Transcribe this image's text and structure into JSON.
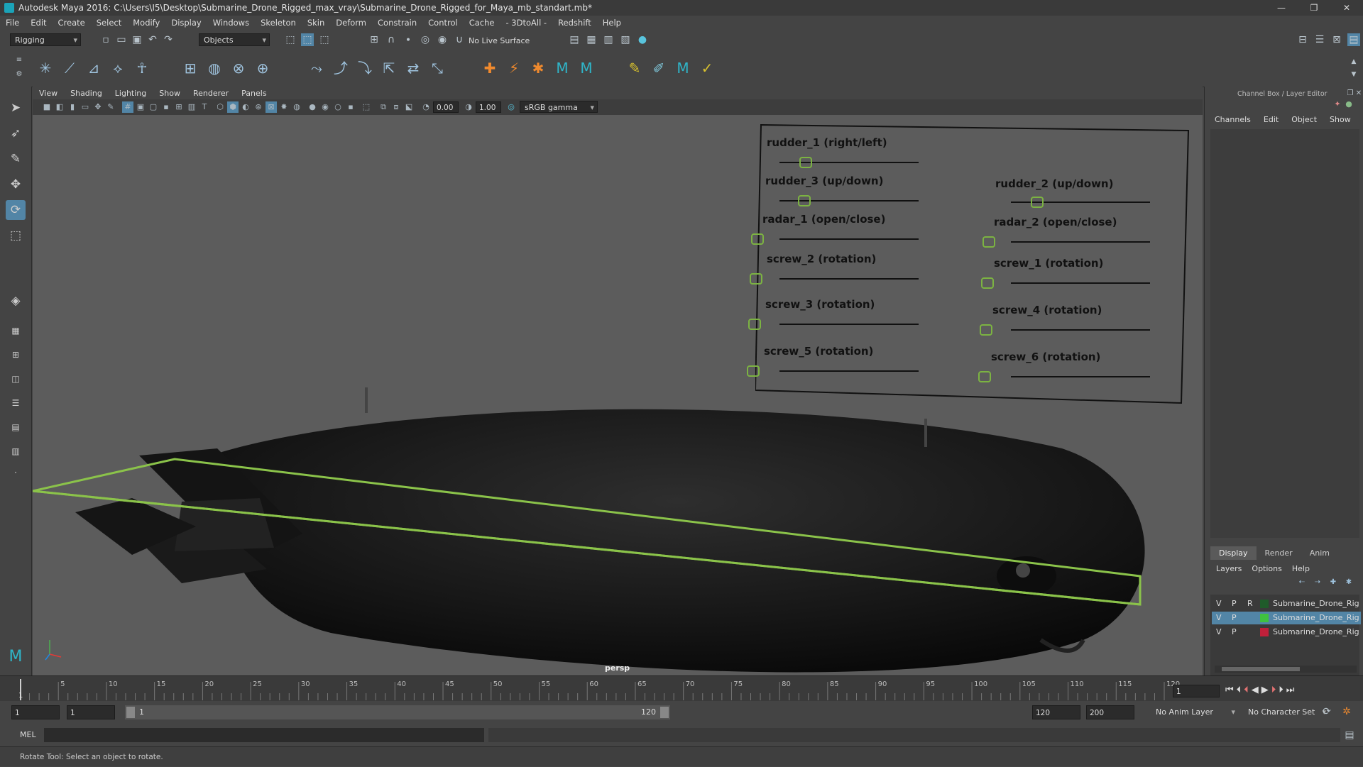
{
  "window": {
    "title": "Autodesk Maya 2016: C:\\Users\\I5\\Desktop\\Submarine_Drone_Rigged_max_vray\\Submarine_Drone_Rigged_for_Maya_mb_standart.mb*",
    "controls": [
      "—",
      "❐",
      "✕"
    ]
  },
  "menubar": [
    "File",
    "Edit",
    "Create",
    "Select",
    "Modify",
    "Display",
    "Windows",
    "Skeleton",
    "Skin",
    "Deform",
    "Constrain",
    "Control",
    "Cache",
    "- 3DtoAll -",
    "Redshift",
    "Help"
  ],
  "statusline": {
    "mode": "Rigging",
    "selection_mode": "Objects",
    "live_surface": "No Live Surface"
  },
  "panel": {
    "menu": [
      "View",
      "Shading",
      "Lighting",
      "Show",
      "Renderer",
      "Panels"
    ],
    "exposure": "0.00",
    "gamma": "1.00",
    "color_space": "sRGB gamma",
    "camera_label": "persp"
  },
  "rig_controls": {
    "left": [
      "rudder_1 (right/left)",
      "rudder_3 (up/down)",
      "radar_1 (open/close)",
      "screw_2 (rotation)",
      "screw_3 (rotation)",
      "screw_5 (rotation)"
    ],
    "right": [
      "rudder_2 (up/down)",
      "radar_2 (open/close)",
      "screw_1 (rotation)",
      "screw_4 (rotation)",
      "screw_6 (rotation)"
    ]
  },
  "channel_box": {
    "title": "Channel Box / Layer Editor",
    "menu": [
      "Channels",
      "Edit",
      "Object",
      "Show"
    ]
  },
  "layer_editor": {
    "tabs": [
      "Display",
      "Render",
      "Anim"
    ],
    "active_tab": "Display",
    "menu": [
      "Layers",
      "Options",
      "Help"
    ],
    "layers": [
      {
        "v": "V",
        "p": "P",
        "r": "R",
        "color": "#1f5b2a",
        "name": "Submarine_Drone_Rig",
        "selected": false
      },
      {
        "v": "V",
        "p": "P",
        "r": "",
        "color": "#3fc13f",
        "name": "Submarine_Drone_Rig",
        "selected": true
      },
      {
        "v": "V",
        "p": "P",
        "r": "",
        "color": "#c0203a",
        "name": "Submarine_Drone_Rig",
        "selected": false
      }
    ]
  },
  "timeline": {
    "ticks": [
      "5",
      "10",
      "15",
      "20",
      "25",
      "30",
      "35",
      "40",
      "45",
      "50",
      "55",
      "60",
      "65",
      "70",
      "75",
      "80",
      "85",
      "90",
      "95",
      "100",
      "105",
      "110",
      "115",
      "120"
    ],
    "start_label": "1",
    "current_frame": "1"
  },
  "range": {
    "start": "1",
    "playback_start": "1",
    "slider_start": "1",
    "slider_end": "120",
    "playback_end": "120",
    "end": "200",
    "anim_layer": "No Anim Layer",
    "character_set": "No Character Set"
  },
  "command_line": {
    "language": "MEL"
  },
  "help_line": "Rotate Tool: Select an object to rotate."
}
